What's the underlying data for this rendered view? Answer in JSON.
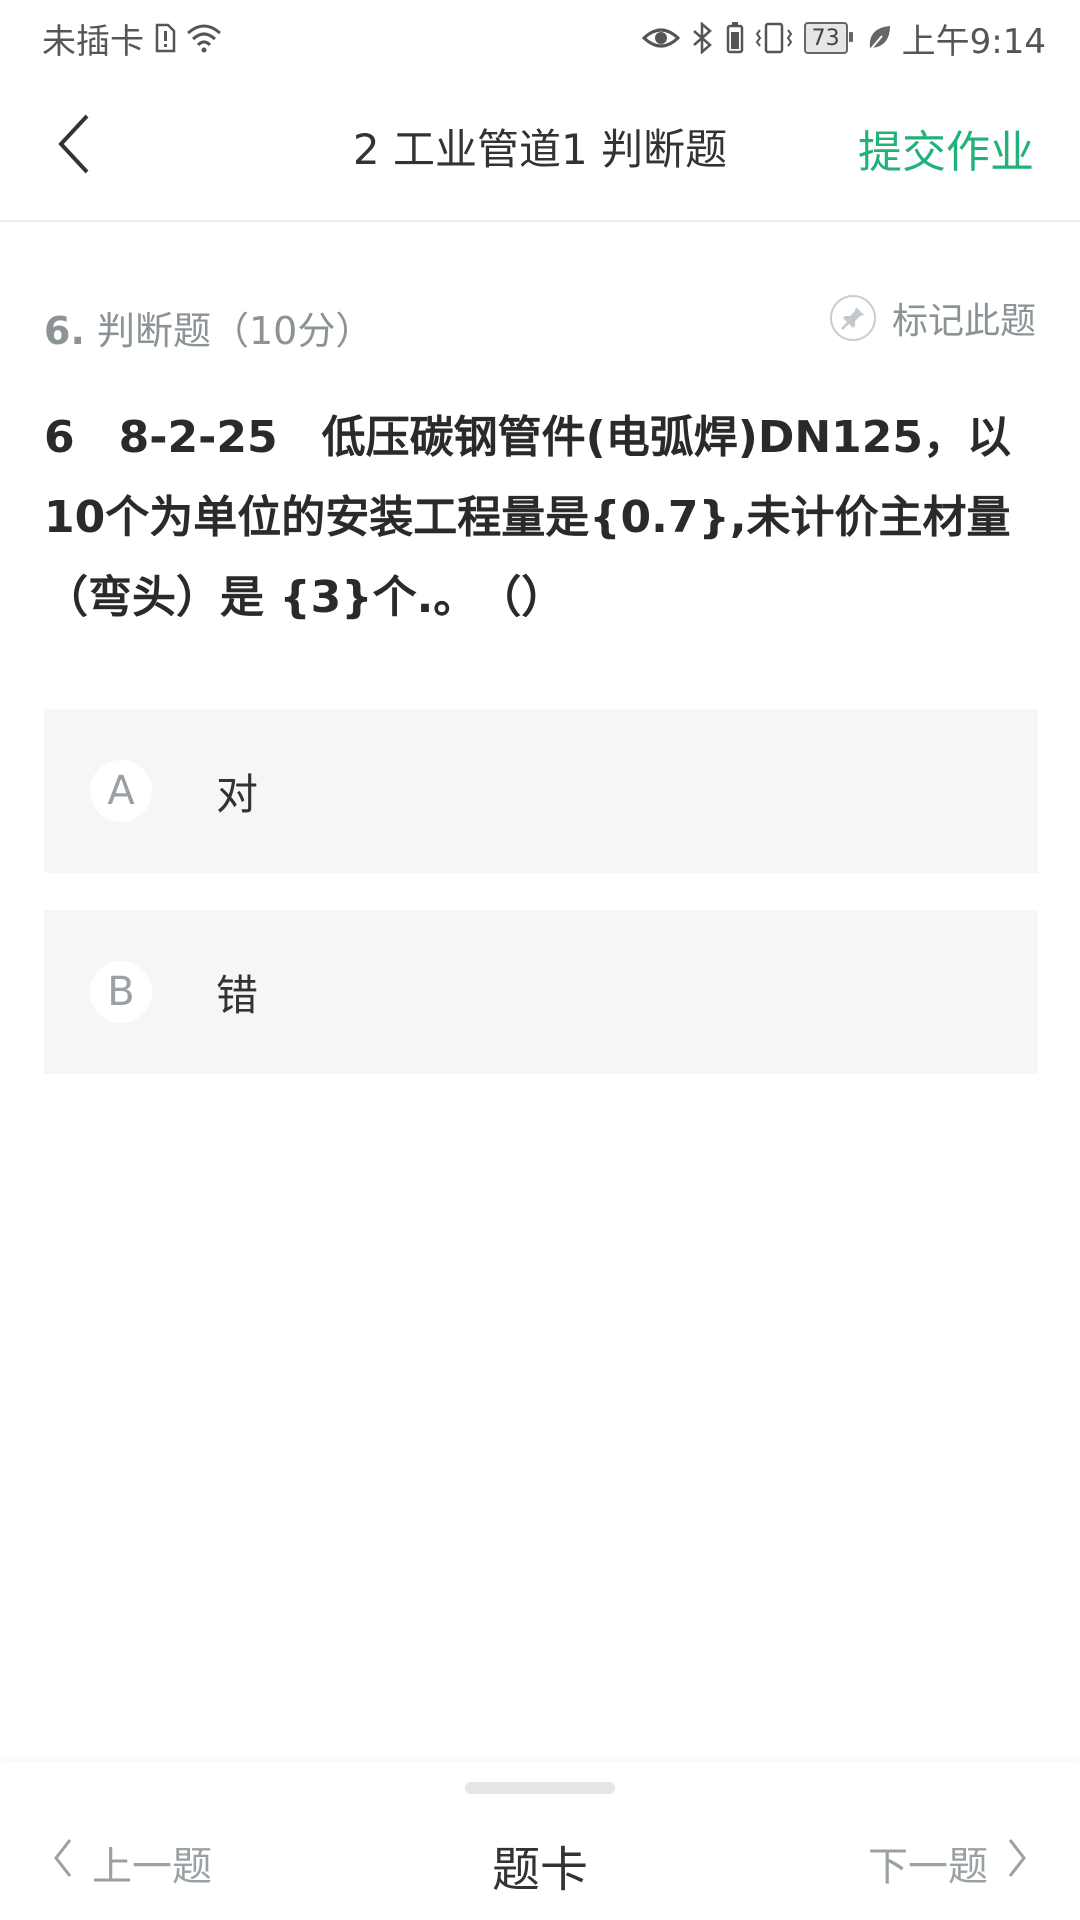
{
  "status_bar": {
    "carrier": "未插卡",
    "battery": "73",
    "time": "上午9:14",
    "icons": [
      "sim-alert-icon",
      "wifi-icon",
      "eye-icon",
      "bluetooth-icon",
      "vibrate-icon",
      "battery-icon",
      "leaf-icon"
    ]
  },
  "nav": {
    "title": "2 工业管道1 判断题",
    "submit_label": "提交作业",
    "back_icon": "chevron-left-icon",
    "accent_color": "#1fb37a"
  },
  "question": {
    "number": "6.",
    "type_label": "判断题（10分）",
    "mark_label": "标记此题",
    "mark_icon": "pin-icon",
    "text": "6　8-2-25　低压碳钢管件(电弧焊)DN125，以10个为单位的安装工程量是{0.7},未计价主材量（弯头）是 {3}个.。　（）"
  },
  "options": [
    {
      "letter": "A",
      "text": "对"
    },
    {
      "letter": "B",
      "text": "错"
    }
  ],
  "bottom_bar": {
    "prev_label": "上一题",
    "card_label": "题卡",
    "next_label": "下一题"
  }
}
